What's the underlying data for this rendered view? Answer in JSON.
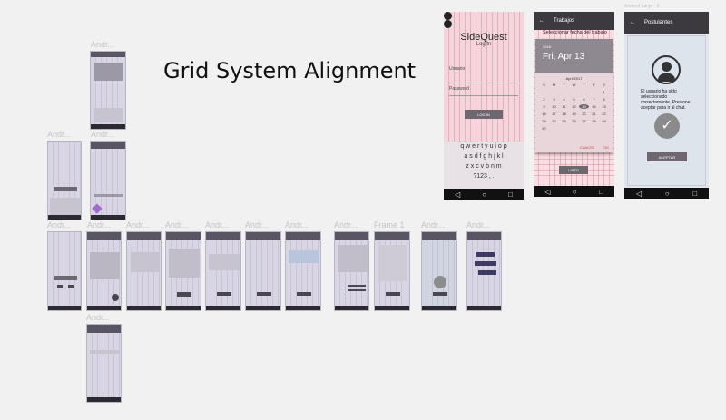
{
  "canvas": {
    "title": "Grid System Alignment",
    "frame_label_android": "Andr...",
    "frame_label_frame1": "Frame 1",
    "frame_label_large": "Android Large - 8"
  },
  "login": {
    "app_name": "SideQuest",
    "heading": "Log In",
    "user_label": "Usuario",
    "password_label": "Password",
    "button": "LOG IN",
    "keyboard_rows": [
      "q w e r t y u i o p",
      "a s d f g h j k l",
      "z x c v b n m",
      "?123 , ."
    ]
  },
  "calendar": {
    "appbar_title": "Trabajos",
    "prompt": "Seleccionar fecha del trabajo",
    "year": "2018",
    "date": "Fri, Apr 13",
    "month": "April 2017",
    "weekdays": [
      "S",
      "M",
      "T",
      "W",
      "T",
      "F",
      "S"
    ],
    "days": [
      "1",
      "2",
      "3",
      "4",
      "5",
      "6",
      "7",
      "8",
      "9",
      "10",
      "11",
      "12",
      "13",
      "14",
      "15",
      "16",
      "17",
      "18",
      "19",
      "20",
      "21",
      "22",
      "23",
      "24",
      "25",
      "26",
      "27",
      "28",
      "29",
      "30"
    ],
    "cancel": "CANCEL",
    "ok": "OK",
    "listo": "LISTO"
  },
  "postulantes": {
    "appbar_title": "Postulantes",
    "message": "El usuario ha sido seleccionado correctamente. Presione aceptar para ir al chat.",
    "button": "ACEPTAR"
  },
  "nav": {
    "back": "◁",
    "home": "○",
    "recent": "□"
  }
}
